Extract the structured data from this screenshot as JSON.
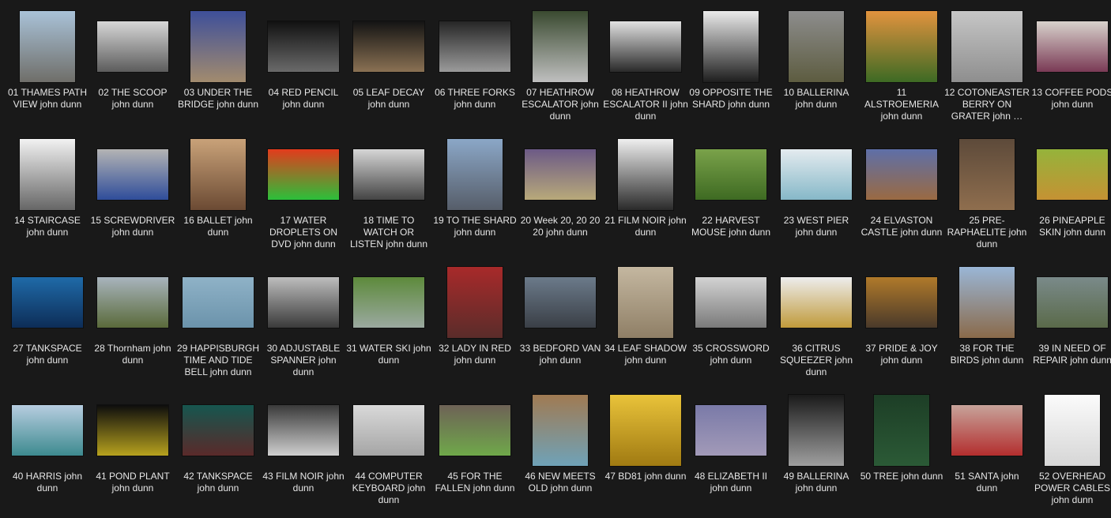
{
  "colors": {
    "background": "#191919",
    "caption_text": "#e6e6e6"
  },
  "items": [
    {
      "label": "01 THAMES PATH VIEW john dunn",
      "shape": "portrait",
      "color_top": "#a9c2d8",
      "color_bottom": "#6f6e69"
    },
    {
      "label": "02 THE SCOOP john dunn",
      "shape": "landscape",
      "color_top": "#d7d7d7",
      "color_bottom": "#5c5c5c"
    },
    {
      "label": "03 UNDER THE BRIDGE john dunn",
      "shape": "portrait",
      "color_top": "#3e4f9a",
      "color_bottom": "#a28b6e"
    },
    {
      "label": "04 RED PENCIL john dunn",
      "shape": "landscape",
      "color_top": "#111111",
      "color_bottom": "#6a6a6a"
    },
    {
      "label": "05 LEAF DECAY john dunn",
      "shape": "landscape",
      "color_top": "#141414",
      "color_bottom": "#8a7153"
    },
    {
      "label": "06 THREE FORKS john dunn",
      "shape": "landscape",
      "color_top": "#262626",
      "color_bottom": "#9b9b9b"
    },
    {
      "label": "07 HEATHROW ESCALATOR john dunn",
      "shape": "portrait",
      "color_top": "#3a4a30",
      "color_bottom": "#bfbfbf"
    },
    {
      "label": "08 HEATHROW ESCALATOR II john dunn",
      "shape": "landscape",
      "color_top": "#e1e1e1",
      "color_bottom": "#2a2a2a"
    },
    {
      "label": "09 OPPOSITE THE SHARD john dunn",
      "shape": "portrait",
      "color_top": "#eaeaea",
      "color_bottom": "#1e1e1e"
    },
    {
      "label": "10 BALLERINA john dunn",
      "shape": "portrait",
      "color_top": "#8d8d8d",
      "color_bottom": "#5d5c40"
    },
    {
      "label": "11 ALSTROEMERIA john dunn",
      "shape": "square",
      "color_top": "#e2933e",
      "color_bottom": "#3d6a24"
    },
    {
      "label": "12 COTONEASTER BERRY ON GRATER john …",
      "shape": "square",
      "color_top": "#c6c6c6",
      "color_bottom": "#8e8e8e"
    },
    {
      "label": "13 COFFEE PODS john dunn",
      "shape": "landscape",
      "color_top": "#d8d2cc",
      "color_bottom": "#7a3a55"
    },
    {
      "label": "14 STAIRCASE john dunn",
      "shape": "portrait",
      "color_top": "#f2f2f2",
      "color_bottom": "#666666"
    },
    {
      "label": "15 SCREWDRIVER john dunn",
      "shape": "landscape",
      "color_top": "#b4b4b4",
      "color_bottom": "#2f4d9a"
    },
    {
      "label": "16 BALLET john dunn",
      "shape": "portrait",
      "color_top": "#c9a279",
      "color_bottom": "#6b4a33"
    },
    {
      "label": "17 WATER DROPLETS ON DVD john dunn",
      "shape": "landscape",
      "color_top": "#e33b1c",
      "color_bottom": "#2bbf3a"
    },
    {
      "label": "18 TIME TO WATCH OR LISTEN john dunn",
      "shape": "landscape",
      "color_top": "#d6d6d6",
      "color_bottom": "#444444"
    },
    {
      "label": "19 TO THE SHARD john dunn",
      "shape": "portrait",
      "color_top": "#8ba7c7",
      "color_bottom": "#565d69"
    },
    {
      "label": "20 Week 20, 20 20 20 john dunn",
      "shape": "landscape",
      "color_top": "#6c5a86",
      "color_bottom": "#b8a97a"
    },
    {
      "label": "21 FILM NOIR john dunn",
      "shape": "portrait",
      "color_top": "#efefef",
      "color_bottom": "#2a2a2a"
    },
    {
      "label": "22 HARVEST MOUSE john dunn",
      "shape": "landscape",
      "color_top": "#7aa24a",
      "color_bottom": "#3e6a22"
    },
    {
      "label": "23 WEST PIER john dunn",
      "shape": "landscape",
      "color_top": "#e4ebef",
      "color_bottom": "#86b8c8"
    },
    {
      "label": "24 ELVASTON CASTLE john dunn",
      "shape": "landscape",
      "color_top": "#5e6fa8",
      "color_bottom": "#9a6a42"
    },
    {
      "label": "25 PRE-RAPHAELITE john dunn",
      "shape": "portrait",
      "color_top": "#5d4a3a",
      "color_bottom": "#8f6e4e"
    },
    {
      "label": "26 PINEAPPLE SKIN john dunn",
      "shape": "landscape",
      "color_top": "#95b33b",
      "color_bottom": "#c59233"
    },
    {
      "label": "27 TANKSPACE john dunn",
      "shape": "landscape",
      "color_top": "#1f6aa8",
      "color_bottom": "#0d2d57"
    },
    {
      "label": "28 Thornham john dunn",
      "shape": "landscape",
      "color_top": "#a8b4bd",
      "color_bottom": "#5a6a3a"
    },
    {
      "label": "29 HAPPISBURGH TIME AND TIDE BELL john dunn",
      "shape": "landscape",
      "color_top": "#8fb2c7",
      "color_bottom": "#6b93ab"
    },
    {
      "label": "30 ADJUSTABLE SPANNER john dunn",
      "shape": "landscape",
      "color_top": "#bdbdbd",
      "color_bottom": "#3a3a3a"
    },
    {
      "label": "31 WATER SKI john dunn",
      "shape": "landscape",
      "color_top": "#5d8a3b",
      "color_bottom": "#9ba9a0"
    },
    {
      "label": "32 LADY IN RED john dunn",
      "shape": "portrait",
      "color_top": "#a82a2a",
      "color_bottom": "#5a2c2a"
    },
    {
      "label": "33 BEDFORD VAN john dunn",
      "shape": "landscape",
      "color_top": "#6b7a8a",
      "color_bottom": "#3a3f46"
    },
    {
      "label": "34 LEAF SHADOW john dunn",
      "shape": "portrait",
      "color_top": "#c4b7a0",
      "color_bottom": "#8f7f66"
    },
    {
      "label": "35 CROSSWORD john dunn",
      "shape": "landscape",
      "color_top": "#d3d3d3",
      "color_bottom": "#7a7a7a"
    },
    {
      "label": "36 CITRUS SQUEEZER john dunn",
      "shape": "landscape",
      "color_top": "#ededed",
      "color_bottom": "#c09a3a"
    },
    {
      "label": "37 PRIDE & JOY john dunn",
      "shape": "landscape",
      "color_top": "#b07a2a",
      "color_bottom": "#4a3a2a"
    },
    {
      "label": "38 FOR THE BIRDS john dunn",
      "shape": "portrait",
      "color_top": "#9ab6d6",
      "color_bottom": "#8a6a4a"
    },
    {
      "label": "39 IN NEED OF REPAIR john dunn",
      "shape": "landscape",
      "color_top": "#7a8a8a",
      "color_bottom": "#5a6a4a"
    },
    {
      "label": "40 HARRIS john dunn",
      "shape": "landscape",
      "color_top": "#b7cde0",
      "color_bottom": "#3d8a8f"
    },
    {
      "label": "41 POND PLANT john dunn",
      "shape": "landscape",
      "color_top": "#0d0d0d",
      "color_bottom": "#b7a21e"
    },
    {
      "label": "42 TANKSPACE john dunn",
      "shape": "landscape",
      "color_top": "#16564f",
      "color_bottom": "#5a2a2a"
    },
    {
      "label": "43 FILM NOIR john dunn",
      "shape": "landscape",
      "color_top": "#3a3a3a",
      "color_bottom": "#cfcfcf"
    },
    {
      "label": "44 COMPUTER KEYBOARD john dunn",
      "shape": "landscape",
      "color_top": "#d9d9d9",
      "color_bottom": "#a5a5a5"
    },
    {
      "label": "45 FOR THE FALLEN john dunn",
      "shape": "landscape",
      "color_top": "#6e6256",
      "color_bottom": "#6fa84a"
    },
    {
      "label": "46 NEW MEETS OLD john dunn",
      "shape": "portrait",
      "color_top": "#a07a52",
      "color_bottom": "#6fa2b8"
    },
    {
      "label": "47 BD81 john dunn",
      "shape": "square",
      "color_top": "#e9c33a",
      "color_bottom": "#a07a12"
    },
    {
      "label": "48 ELIZABETH II john dunn",
      "shape": "landscape",
      "color_top": "#7a7aa8",
      "color_bottom": "#a29ab8"
    },
    {
      "label": "49 BALLERINA john dunn",
      "shape": "portrait",
      "color_top": "#1a1a1a",
      "color_bottom": "#9f9f9f"
    },
    {
      "label": "50 TREE john dunn",
      "shape": "portrait",
      "color_top": "#1d3e26",
      "color_bottom": "#2b5a36"
    },
    {
      "label": "51 SANTA john dunn",
      "shape": "landscape",
      "color_top": "#c7a39a",
      "color_bottom": "#b32e2e"
    },
    {
      "label": "52 OVERHEAD POWER CABLES john dunn",
      "shape": "portrait",
      "color_top": "#fbfbfb",
      "color_bottom": "#d6d6d6"
    }
  ]
}
